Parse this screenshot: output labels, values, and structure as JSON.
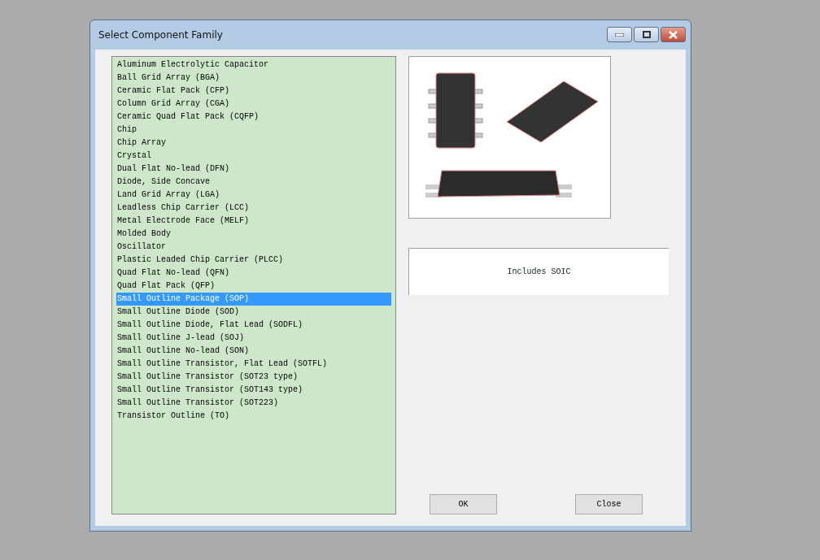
{
  "window": {
    "title": "Select Component Family"
  },
  "families": [
    {
      "label": "Aluminum Electrolytic Capacitor",
      "selected": false
    },
    {
      "label": "Ball Grid Array (BGA)",
      "selected": false
    },
    {
      "label": "Ceramic Flat Pack (CFP)",
      "selected": false
    },
    {
      "label": "Column Grid Array (CGA)",
      "selected": false
    },
    {
      "label": "Ceramic Quad Flat Pack (CQFP)",
      "selected": false
    },
    {
      "label": "Chip",
      "selected": false
    },
    {
      "label": "Chip Array",
      "selected": false
    },
    {
      "label": "Crystal",
      "selected": false
    },
    {
      "label": "Dual Flat No-lead (DFN)",
      "selected": false
    },
    {
      "label": "Diode, Side Concave",
      "selected": false
    },
    {
      "label": "Land Grid Array (LGA)",
      "selected": false
    },
    {
      "label": "Leadless Chip Carrier (LCC)",
      "selected": false
    },
    {
      "label": "Metal Electrode Face (MELF)",
      "selected": false
    },
    {
      "label": "Molded Body",
      "selected": false
    },
    {
      "label": "Oscillator",
      "selected": false
    },
    {
      "label": "Plastic Leaded Chip Carrier (PLCC)",
      "selected": false
    },
    {
      "label": "Quad Flat No-lead (QFN)",
      "selected": false
    },
    {
      "label": "Quad Flat Pack (QFP)",
      "selected": false
    },
    {
      "label": "Small Outline Package (SOP)",
      "selected": true
    },
    {
      "label": "Small Outline Diode (SOD)",
      "selected": false
    },
    {
      "label": "Small Outline Diode, Flat Lead (SODFL)",
      "selected": false
    },
    {
      "label": "Small Outline J-lead (SOJ)",
      "selected": false
    },
    {
      "label": "Small Outline No-lead (SON)",
      "selected": false
    },
    {
      "label": "Small Outline Transistor, Flat Lead (SOTFL)",
      "selected": false
    },
    {
      "label": "Small Outline Transistor (SOT23 type)",
      "selected": false
    },
    {
      "label": "Small Outline Transistor (SOT143 type)",
      "selected": false
    },
    {
      "label": "Small Outline Transistor (SOT223)",
      "selected": false
    },
    {
      "label": "Transistor Outline (TO)",
      "selected": false
    }
  ],
  "description": "Includes SOIC",
  "buttons": [
    "OK",
    "Close"
  ]
}
